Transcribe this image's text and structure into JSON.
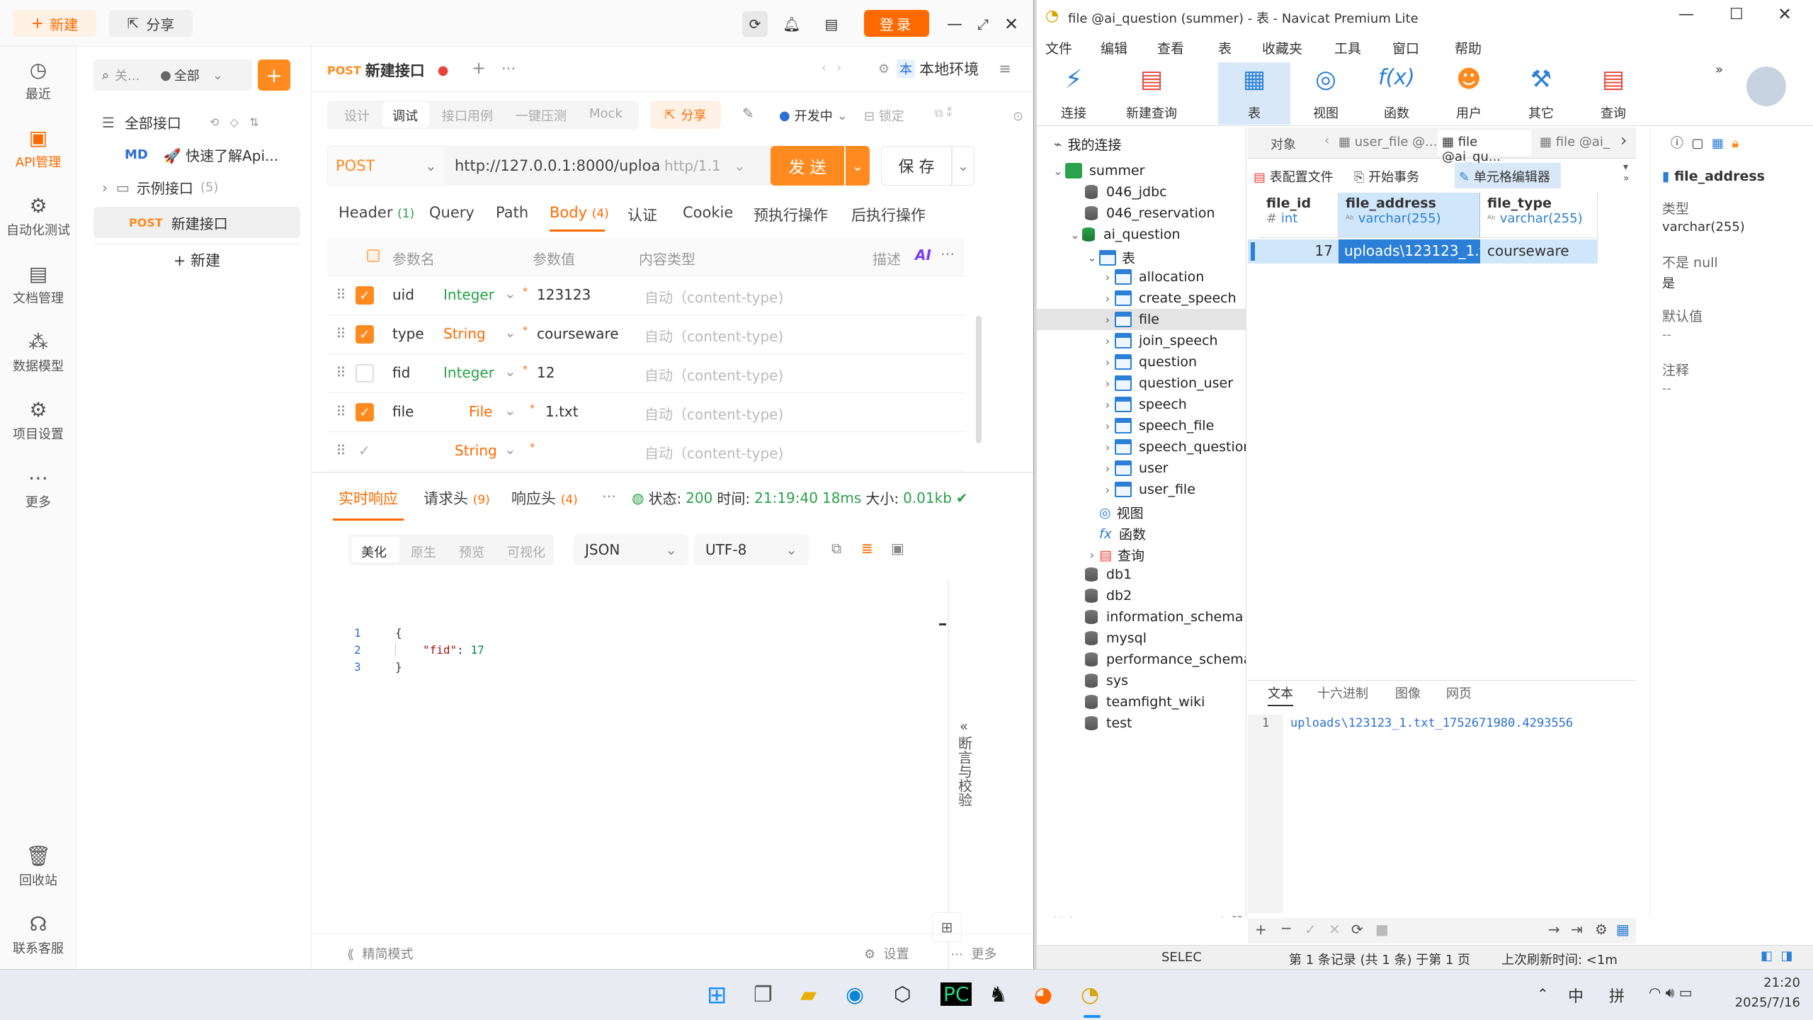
{
  "apifox": {
    "top": {
      "new_label": "新建",
      "share_label": "分享",
      "login_label": "登录"
    },
    "side": [
      {
        "label": "最近",
        "icon": "clock-icon"
      },
      {
        "label": "API管理",
        "icon": "api-icon"
      },
      {
        "label": "自动化测试",
        "icon": "automation-icon"
      },
      {
        "label": "文档管理",
        "icon": "doc-icon"
      },
      {
        "label": "数据模型",
        "icon": "model-icon"
      },
      {
        "label": "项目设置",
        "icon": "settings-icon"
      },
      {
        "label": "更多",
        "icon": "more-icon"
      },
      {
        "label": "回收站",
        "icon": "trash-icon"
      },
      {
        "label": "联系客服",
        "icon": "headset-icon"
      }
    ],
    "tree": {
      "search_placeholder": "关...",
      "filter": "全部",
      "all_label": "全部接口",
      "md_badge": "MD",
      "md_item": "🚀 快速了解Api...",
      "folder": "示例接口",
      "folder_count": "(5)",
      "method": "POST",
      "endpoint": "新建接口",
      "new_label": "+ 新建"
    },
    "tab": {
      "method": "POST",
      "title": "新建接口",
      "env": "本地环境"
    },
    "modes": [
      "设计",
      "调试",
      "接口用例",
      "一键压测",
      "Mock"
    ],
    "share2": "分享",
    "dev_env": "开发中",
    "lock": "锁定",
    "request": {
      "method": "POST",
      "url": "http://127.0.0.1:8000/uploa",
      "proto": "http/1.1",
      "send": "发 送",
      "save": "保 存"
    },
    "param_tabs": [
      {
        "label": "Header",
        "count": "(1)"
      },
      {
        "label": "Query",
        "count": ""
      },
      {
        "label": "Path",
        "count": ""
      },
      {
        "label": "Body",
        "count": "(4)"
      },
      {
        "label": "认证",
        "count": ""
      },
      {
        "label": "Cookie",
        "count": ""
      },
      {
        "label": "预执行操作",
        "count": ""
      },
      {
        "label": "后执行操作",
        "count": ""
      }
    ],
    "table_head": {
      "name": "参数名",
      "value": "参数值",
      "ctype": "内容类型",
      "desc": "描述",
      "ai": "AI"
    },
    "params": [
      {
        "name": "uid",
        "type": "Integer",
        "value": "123123",
        "ctype": "自动（content-type)",
        "checked": true
      },
      {
        "name": "type",
        "type": "String",
        "value": "courseware",
        "ctype": "自动（content-type)",
        "checked": true
      },
      {
        "name": "fid",
        "type": "Integer",
        "value": "12",
        "ctype": "自动（content-type)",
        "checked": false
      },
      {
        "name": "file",
        "type": "File",
        "value": "1.txt",
        "ctype": "自动（content-type)",
        "checked": true
      },
      {
        "name": "",
        "type": "String",
        "value": "",
        "ctype": "自动（content-type)",
        "checked": false
      }
    ],
    "resp_tabs": [
      {
        "label": "实时响应",
        "count": ""
      },
      {
        "label": "请求头",
        "count": "(9)"
      },
      {
        "label": "响应头",
        "count": "(4)"
      }
    ],
    "status": {
      "label": "状态:",
      "code": "200",
      "time_label": "时间:",
      "time": "21:19:40",
      "ms": "18ms",
      "size_label": "大小:",
      "size": "0.01kb"
    },
    "view_modes": [
      "美化",
      "原生",
      "预览",
      "可视化"
    ],
    "format": "JSON",
    "encoding": "UTF-8",
    "code_lines": [
      {
        "no": "1",
        "text": "{"
      },
      {
        "no": "2",
        "key": "\"fid\"",
        "val": "17"
      },
      {
        "no": "3",
        "text": "}"
      }
    ],
    "assert_label": "断言与校验",
    "bottom": {
      "simple": "精简模式",
      "settings": "设置",
      "more": "更多"
    }
  },
  "navicat": {
    "title": "file @ai_question (summer) - 表 - Navicat Premium Lite",
    "menu": [
      "文件",
      "编辑",
      "查看",
      "表",
      "收藏夹",
      "工具",
      "窗口",
      "帮助"
    ],
    "toolbar": [
      {
        "label": "连接",
        "icon": "connect-icon"
      },
      {
        "label": "新建查询",
        "icon": "new-query-icon"
      },
      {
        "label": "表",
        "icon": "table-icon"
      },
      {
        "label": "视图",
        "icon": "view-icon"
      },
      {
        "label": "函数",
        "icon": "function-icon"
      },
      {
        "label": "用户",
        "icon": "user-icon"
      },
      {
        "label": "其它",
        "icon": "tools-icon"
      },
      {
        "label": "查询",
        "icon": "query-icon"
      }
    ],
    "tree": {
      "root": "我的连接",
      "conn": "summer",
      "dbs_before": [
        "046_jdbc",
        "046_reservation"
      ],
      "open_db": "ai_question",
      "tables_label": "表",
      "tables": [
        "allocation",
        "create_speech",
        "file",
        "join_speech",
        "question",
        "question_user",
        "speech",
        "speech_file",
        "speech_question",
        "user",
        "user_file"
      ],
      "views": "视图",
      "funcs": "函数",
      "queries": "查询",
      "dbs_after": [
        "db1",
        "db2",
        "information_schema",
        "mysql",
        "performance_schema",
        "sys",
        "teamfight_wiki",
        "test"
      ],
      "search": "搜索"
    },
    "obj_tabs": [
      "对象",
      "user_file @...",
      "file @ai_qu...",
      "file @ai_"
    ],
    "actions": [
      "表配置文件",
      "开始事务",
      "单元格编辑器"
    ],
    "columns": [
      {
        "name": "file_id",
        "type": "int"
      },
      {
        "name": "file_address",
        "type": "varchar(255)"
      },
      {
        "name": "file_type",
        "type": "varchar(255)"
      }
    ],
    "row": [
      "17",
      "uploads\\123123_1.tx",
      "courseware"
    ],
    "editor_tabs": [
      "文本",
      "十六进制",
      "图像",
      "网页"
    ],
    "editor_line_no": "1",
    "editor_text": "uploads\\123123_1.txt_1752671980.4293556",
    "info": {
      "field": "file_address",
      "type_label": "类型",
      "type": "varchar(255)",
      "null_label": "不是 null",
      "null": "是",
      "default_label": "默认值",
      "default": "--",
      "comment_label": "注释",
      "comment": "--"
    },
    "status": {
      "sql": "SELEC",
      "records": "第 1 条记录 (共 1 条) 于第 1 页",
      "refresh": "上次刷新时间: <1m"
    }
  },
  "taskbar": {
    "ime1": "中",
    "ime2": "拼",
    "time": "21:20",
    "date": "2025/7/16"
  },
  "colors": {
    "accent": "#ff6a00",
    "navicat_blue": "#2c7fd6",
    "select": "#cfe6fb"
  }
}
